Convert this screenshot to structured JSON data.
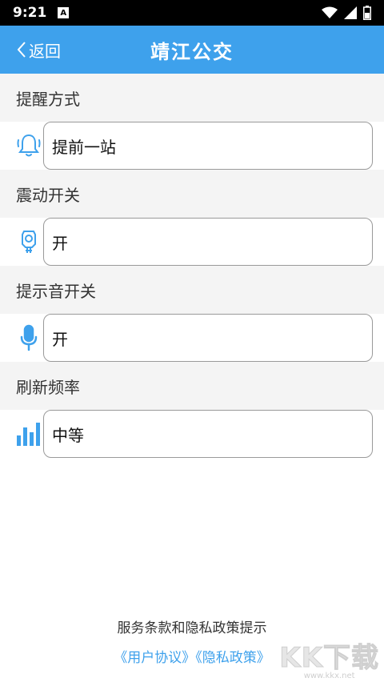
{
  "status_bar": {
    "time": "9:21",
    "notification": "A"
  },
  "header": {
    "back_label": "返回",
    "title": "靖江公交"
  },
  "settings": [
    {
      "label": "提醒方式",
      "value": "提前一站",
      "icon": "bell-icon"
    },
    {
      "label": "震动开关",
      "value": "开",
      "icon": "vibrate-icon"
    },
    {
      "label": "提示音开关",
      "value": "开",
      "icon": "microphone-icon"
    },
    {
      "label": "刷新频率",
      "value": "中等",
      "icon": "frequency-bars-icon"
    }
  ],
  "footer": {
    "notice": "服务条款和隐私政策提示",
    "user_agreement": "《用户协议》",
    "privacy_policy": "《隐私政策》"
  },
  "watermark": {
    "logo": "KK下载",
    "url": "www.kkx.net"
  },
  "colors": {
    "accent": "#3ea1ec",
    "section_bg": "#f4f4f4"
  }
}
